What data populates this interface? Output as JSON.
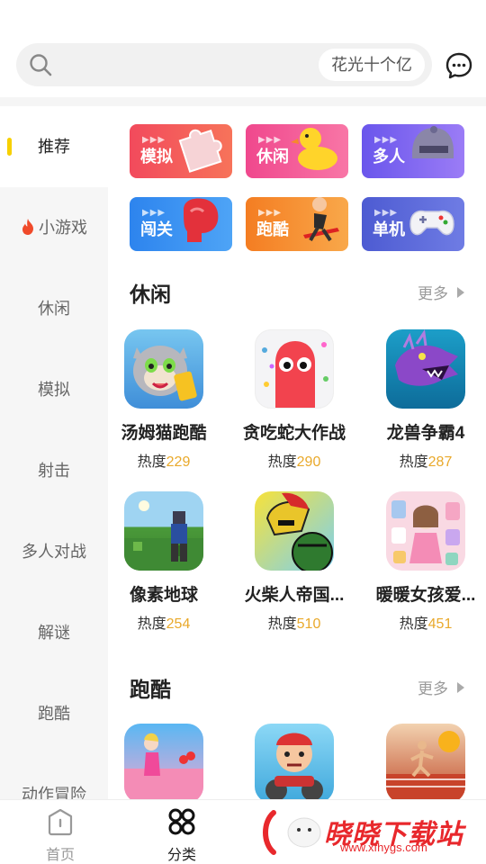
{
  "search": {
    "hint": "花光十个亿"
  },
  "sidebar": {
    "items": [
      {
        "label": "推荐",
        "active": true
      },
      {
        "label": "小游戏",
        "icon": "fire-icon"
      },
      {
        "label": "休闲"
      },
      {
        "label": "模拟"
      },
      {
        "label": "射击"
      },
      {
        "label": "多人对战"
      },
      {
        "label": "解谜"
      },
      {
        "label": "跑酷"
      },
      {
        "label": "动作冒险"
      }
    ]
  },
  "categories": [
    {
      "label": "模拟",
      "icon": "puzzle-icon",
      "color": "#f2545b"
    },
    {
      "label": "休闲",
      "icon": "duck-icon",
      "color": "#f0538a"
    },
    {
      "label": "多人",
      "icon": "helmet-icon",
      "color": "#7b5cf0"
    },
    {
      "label": "闯关",
      "icon": "boxing-glove-icon",
      "color": "#3b8df0"
    },
    {
      "label": "跑酷",
      "icon": "runner-icon",
      "color": "#f6892c"
    },
    {
      "label": "单机",
      "icon": "gamepad-icon",
      "color": "#5a68d8"
    }
  ],
  "sections": [
    {
      "title": "休闲",
      "more": "更多",
      "games": [
        {
          "name": "汤姆猫跑酷",
          "heat_label": "热度",
          "heat": "229"
        },
        {
          "name": "贪吃蛇大作战",
          "heat_label": "热度",
          "heat": "290"
        },
        {
          "name": "龙兽争霸4",
          "heat_label": "热度",
          "heat": "287"
        },
        {
          "name": "像素地球",
          "heat_label": "热度",
          "heat": "254"
        },
        {
          "name": "火柴人帝国...",
          "heat_label": "热度",
          "heat": "510"
        },
        {
          "name": "暖暖女孩爱...",
          "heat_label": "热度",
          "heat": "451"
        }
      ]
    },
    {
      "title": "跑酷",
      "more": "更多",
      "games": [
        {},
        {},
        {}
      ]
    }
  ],
  "tabbar": {
    "tabs": [
      {
        "label": "首页",
        "icon": "home-icon"
      },
      {
        "label": "分类",
        "icon": "category-icon",
        "active": true
      }
    ]
  },
  "watermark": {
    "text": "晓晓下载站",
    "url": "www.xfhygs.com"
  }
}
